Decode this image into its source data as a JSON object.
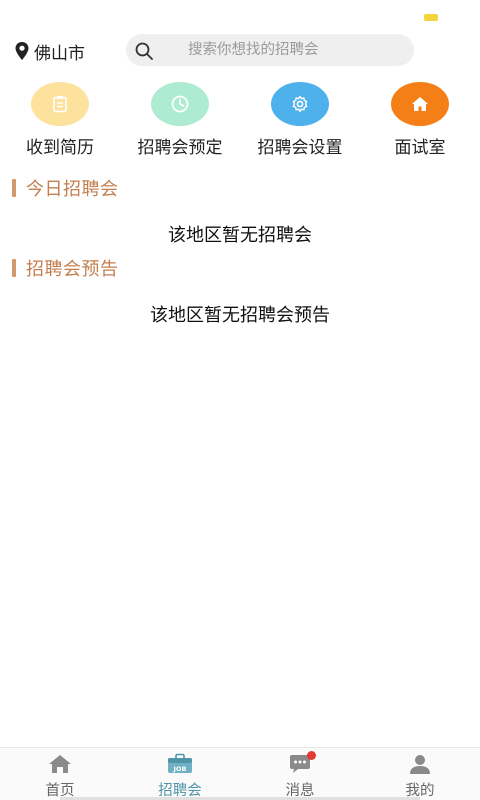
{
  "status": {
    "indicator_color": "#f2d53c"
  },
  "header": {
    "location": "佛山市",
    "search_placeholder": "搜索你想找的招聘会",
    "location_icon": "location-pin-icon",
    "search_icon": "search-icon"
  },
  "quick_menu": {
    "items": [
      {
        "label": "收到简历",
        "icon": "clipboard-icon",
        "color": "#fde29e"
      },
      {
        "label": "招聘会预定",
        "icon": "clock-icon",
        "color": "#aeebd3"
      },
      {
        "label": "招聘会设置",
        "icon": "gear-icon",
        "color": "#4fb1ec"
      },
      {
        "label": "面试室",
        "icon": "house-icon",
        "color": "#f57f17"
      }
    ]
  },
  "sections": {
    "today": {
      "title": "今日招聘会",
      "empty": "该地区暂无招聘会"
    },
    "preview": {
      "title": "招聘会预告",
      "empty": "该地区暂无招聘会预告"
    }
  },
  "bottom_nav": {
    "items": [
      {
        "label": "首页",
        "icon": "home-icon"
      },
      {
        "label": "招聘会",
        "icon": "job-bag-icon",
        "active": true
      },
      {
        "label": "消息",
        "icon": "chat-bubble-icon",
        "badge": true
      },
      {
        "label": "我的",
        "icon": "user-icon"
      }
    ]
  },
  "colors": {
    "accent": "#c47f4f",
    "active_tab": "#4f94a8"
  }
}
